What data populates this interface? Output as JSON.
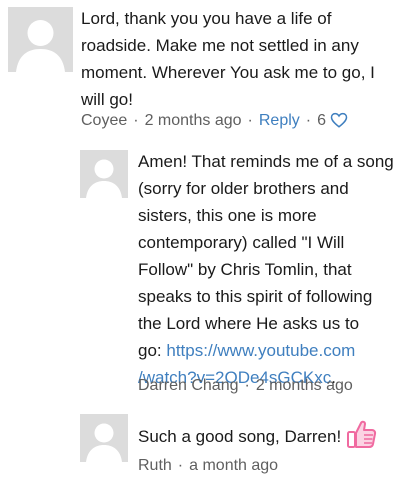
{
  "comments": [
    {
      "text": "Lord, thank you you have a life of\nroadside. Make me not settled in any\nmoment. Wherever You ask me to go, I\nwill go!",
      "author": "Coyee",
      "time": "2 months ago",
      "reply_label": "Reply",
      "like_count": "6",
      "heart_icon": "heart-outline-icon"
    },
    {
      "text_before_link": "Amen! That reminds me of a song\n(sorry for older brothers and\nsisters, this one is more\ncontemporary) called \"I Will\nFollow\" by Chris Tomlin, that\nspeaks to this spirit of following\nthe Lord where He asks us to\ngo: ",
      "link_line1": "https://www.youtube.com",
      "link_line2": "/watch?v=2ODe4sGCKxc",
      "text_after_link": ".",
      "author": "Darren Chang",
      "time": "2 months ago"
    },
    {
      "text": "Such a good song, Darren!",
      "emoji_icon": "thumbs-up-icon",
      "author": "Ruth",
      "time": "a month ago"
    }
  ],
  "colors": {
    "link": "#3f7fbf",
    "meta": "#5f5f5f",
    "avatar_bg": "#dcdcdc",
    "thumbs_pink": "#f06aa0"
  }
}
